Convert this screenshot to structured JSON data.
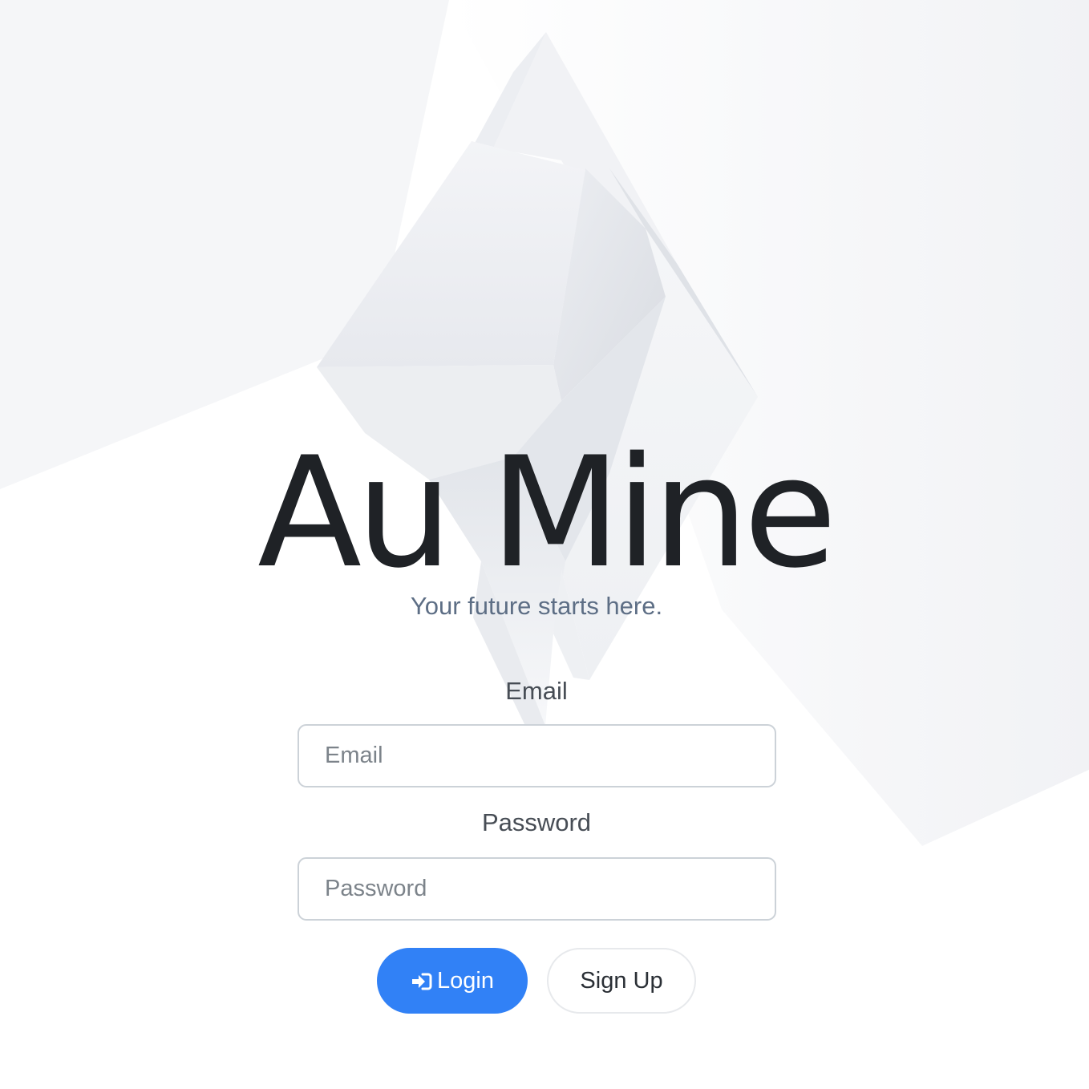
{
  "brand": {
    "title": "Au Mine",
    "tagline": "Your future starts here."
  },
  "form": {
    "email_label": "Email",
    "email_placeholder": "Email",
    "password_label": "Password",
    "password_placeholder": "Password"
  },
  "actions": {
    "login_label": "Login",
    "signup_label": "Sign Up"
  },
  "icons": {
    "login": "sign-in-icon"
  },
  "colors": {
    "primary": "#3181f6",
    "title": "#1f2226",
    "tagline": "#5d6e85",
    "label": "#474d55",
    "input_border": "#ccd2d8"
  }
}
